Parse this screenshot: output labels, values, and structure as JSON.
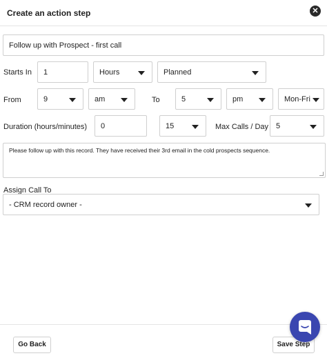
{
  "header": {
    "title": "Create an action step",
    "close_glyph": "✕"
  },
  "form": {
    "step_name": "Follow up with Prospect - first call",
    "starts_in": {
      "label": "Starts In",
      "value": "1",
      "unit": "Hours",
      "status": "Planned"
    },
    "window": {
      "from_label": "From",
      "from_hour": "9",
      "from_period": "am",
      "to_label": "To",
      "to_hour": "5",
      "to_period": "pm",
      "days": "Mon-Fri"
    },
    "duration": {
      "label": "Duration (hours/minutes)",
      "hours": "0",
      "minutes": "15",
      "max_calls_label": "Max Calls / Day",
      "max_calls": "5"
    },
    "notes": "Please follow up with this record. They have received their 3rd email in the cold prospects sequence.",
    "assign": {
      "label": "Assign Call To",
      "value": "- CRM record owner -"
    }
  },
  "footer": {
    "back_label": "Go Back",
    "save_label": "Save Step"
  },
  "icons": {
    "close": "close-icon",
    "chat": "chat-icon",
    "dropdown": "chevron-down-icon"
  },
  "colors": {
    "chat_accent": "#3a46b0"
  }
}
